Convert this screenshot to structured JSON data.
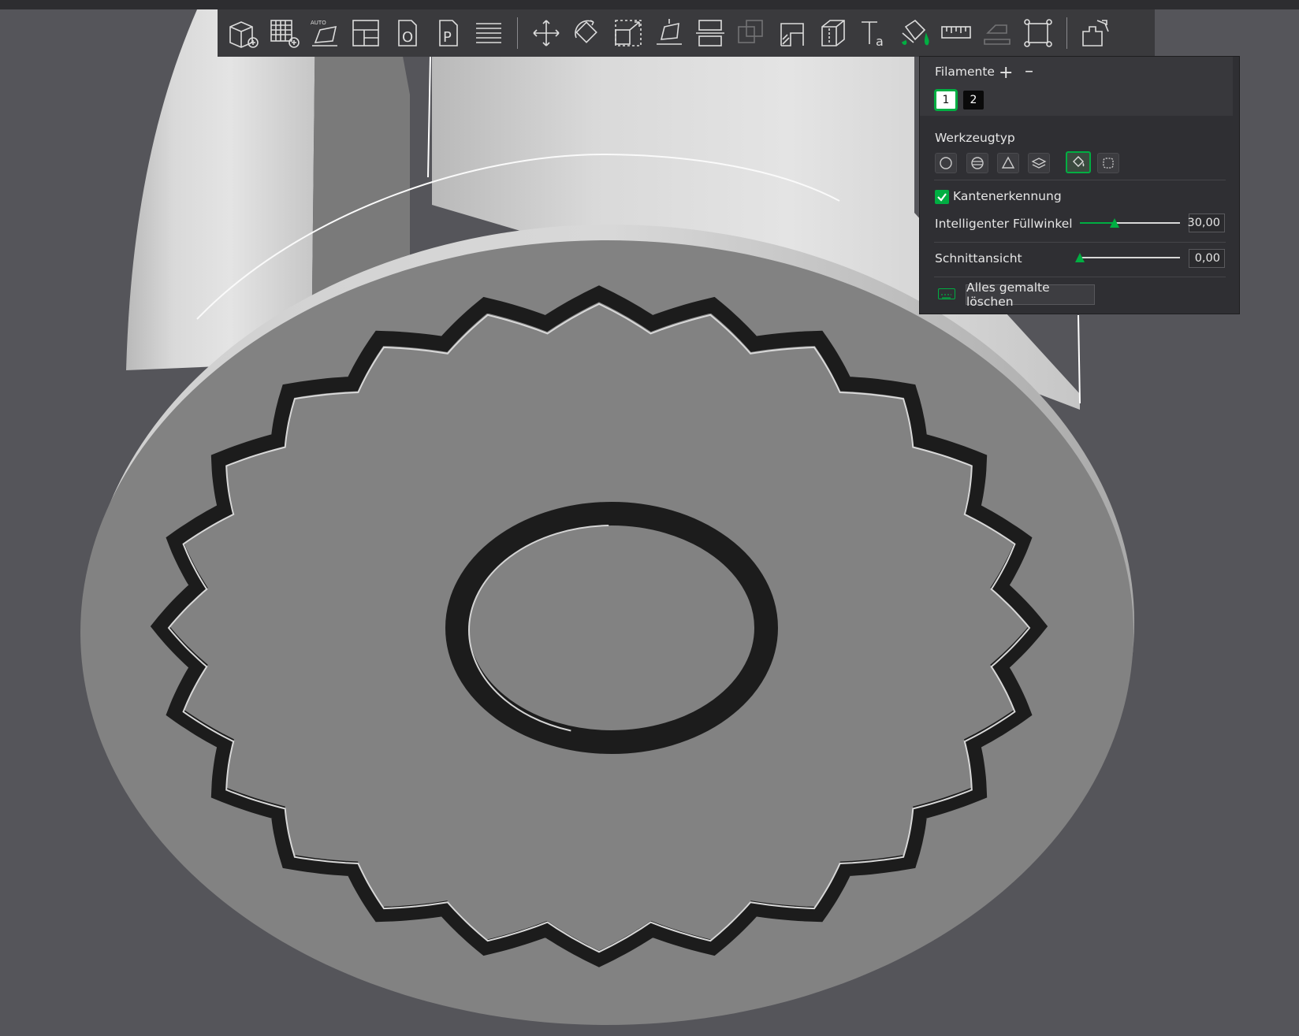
{
  "toolbar": {
    "items": [
      {
        "name": "add-object-icon"
      },
      {
        "name": "add-plate-icon"
      },
      {
        "name": "auto-orient-icon"
      },
      {
        "name": "arrange-icon"
      },
      {
        "name": "split-objects-icon"
      },
      {
        "name": "split-parts-icon"
      },
      {
        "name": "layers-icon"
      },
      {
        "sep": true
      },
      {
        "name": "move-icon"
      },
      {
        "name": "rotate-icon"
      },
      {
        "name": "scale-icon"
      },
      {
        "name": "lay-on-face-icon"
      },
      {
        "name": "cut-icon"
      },
      {
        "name": "boolean-icon",
        "dim": true
      },
      {
        "name": "support-paint-icon"
      },
      {
        "name": "seam-paint-icon"
      },
      {
        "name": "text-tool-icon"
      },
      {
        "name": "color-paint-icon"
      },
      {
        "name": "measure-icon"
      },
      {
        "name": "assembly-icon",
        "dim": true
      },
      {
        "name": "fit-view-icon"
      },
      {
        "sep": true
      },
      {
        "name": "explode-icon"
      }
    ]
  },
  "panel": {
    "filaments_label": "Filamente",
    "filaments": [
      "1",
      "2"
    ],
    "selected_filament": "1",
    "tool_type_label": "Werkzeugtyp",
    "tool_types": [
      "circle-brush",
      "sphere-brush",
      "triangle-brush",
      "height-range",
      "fill-bucket",
      "gap-fill"
    ],
    "active_tool": "fill-bucket",
    "edge_detection_label": "Kantenerkennung",
    "edge_detection_checked": true,
    "smart_fill_label": "Intelligenter Füllwinkel",
    "smart_fill_value": "30,00",
    "smart_fill_fraction": 0.35,
    "section_view_label": "Schnittansicht",
    "section_view_value": "0,00",
    "section_view_fraction": 0.0,
    "clear_all_label": "Alles gemalte löschen"
  },
  "colors": {
    "accent": "#00ae42",
    "background": "#55555a",
    "panel": "#2f2f33"
  }
}
